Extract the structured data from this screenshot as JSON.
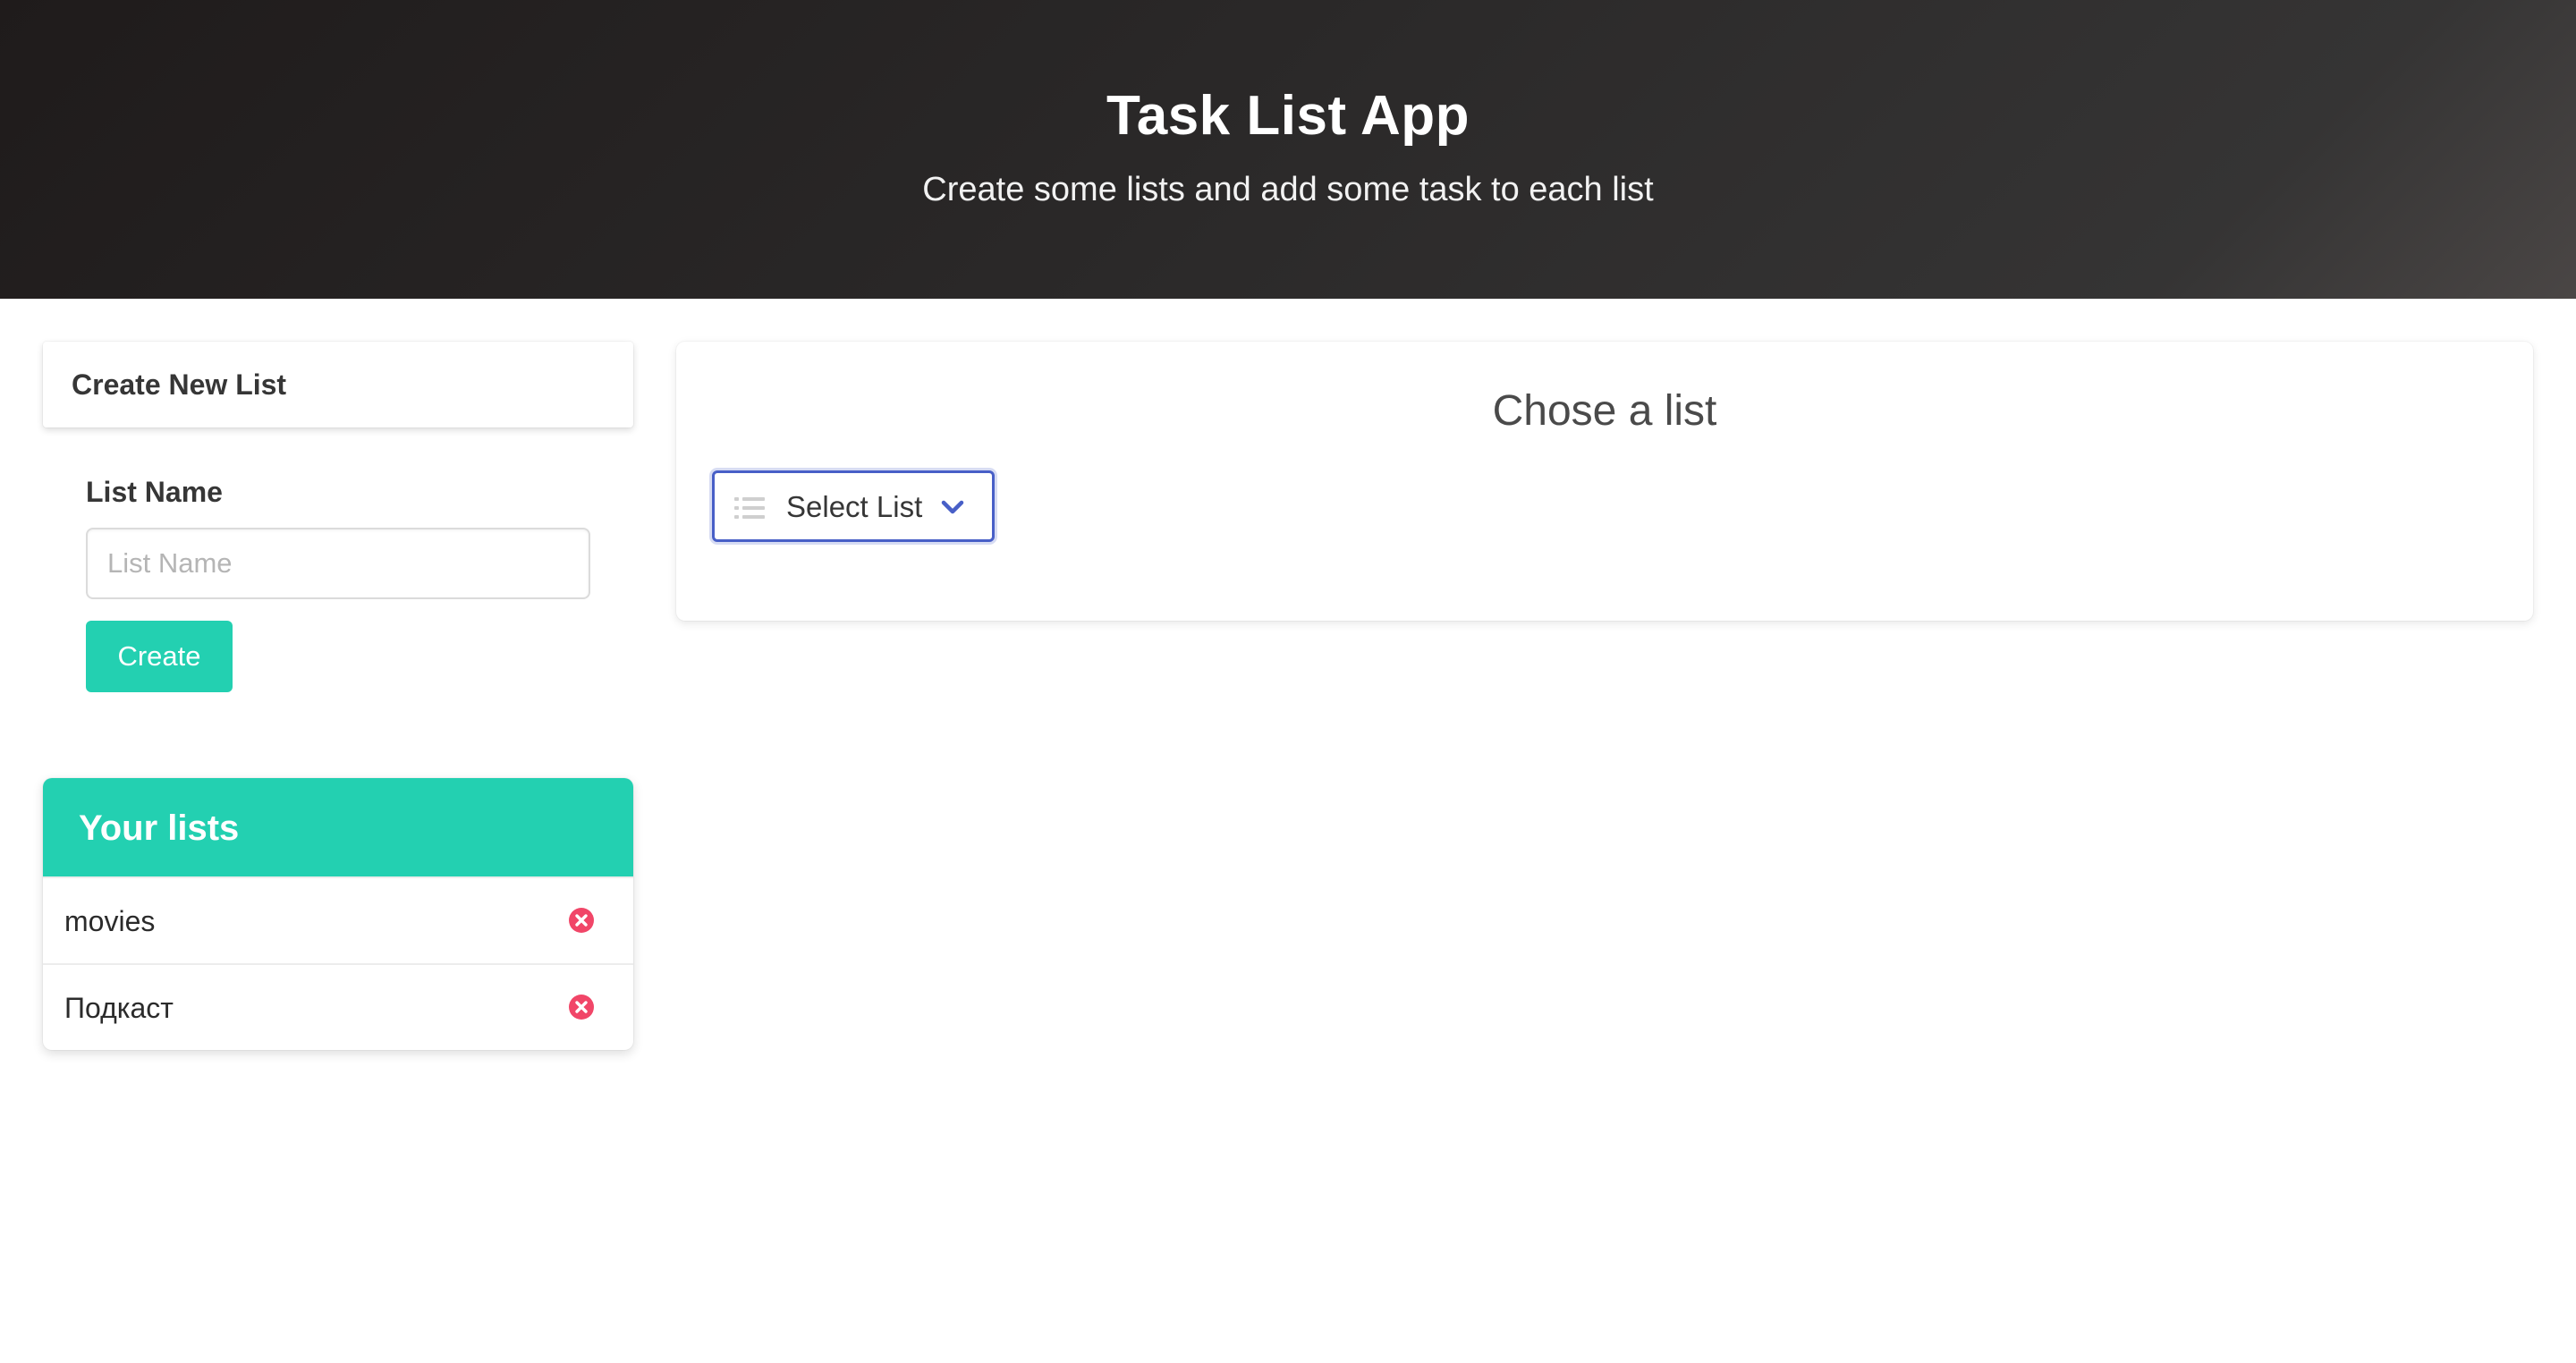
{
  "header": {
    "title": "Task List App",
    "subtitle": "Create some lists and add some task to each list"
  },
  "create_list": {
    "card_title": "Create New List",
    "field_label": "List Name",
    "input_placeholder": "List Name",
    "input_value": "",
    "create_button_label": "Create"
  },
  "your_lists": {
    "heading": "Your lists",
    "items": [
      {
        "label": "movies",
        "delete_icon": "close-circle-icon"
      },
      {
        "label": "Подкаст",
        "delete_icon": "close-circle-icon"
      }
    ]
  },
  "chooser": {
    "title": "Chose a list",
    "select_label": "Select List",
    "select_icon": "list-icon",
    "select_chevron": "chevron-down-icon"
  },
  "colors": {
    "accent": "#23d0b1",
    "danger": "#f14668",
    "focus": "#485fc7",
    "header_bg": "#242121"
  }
}
